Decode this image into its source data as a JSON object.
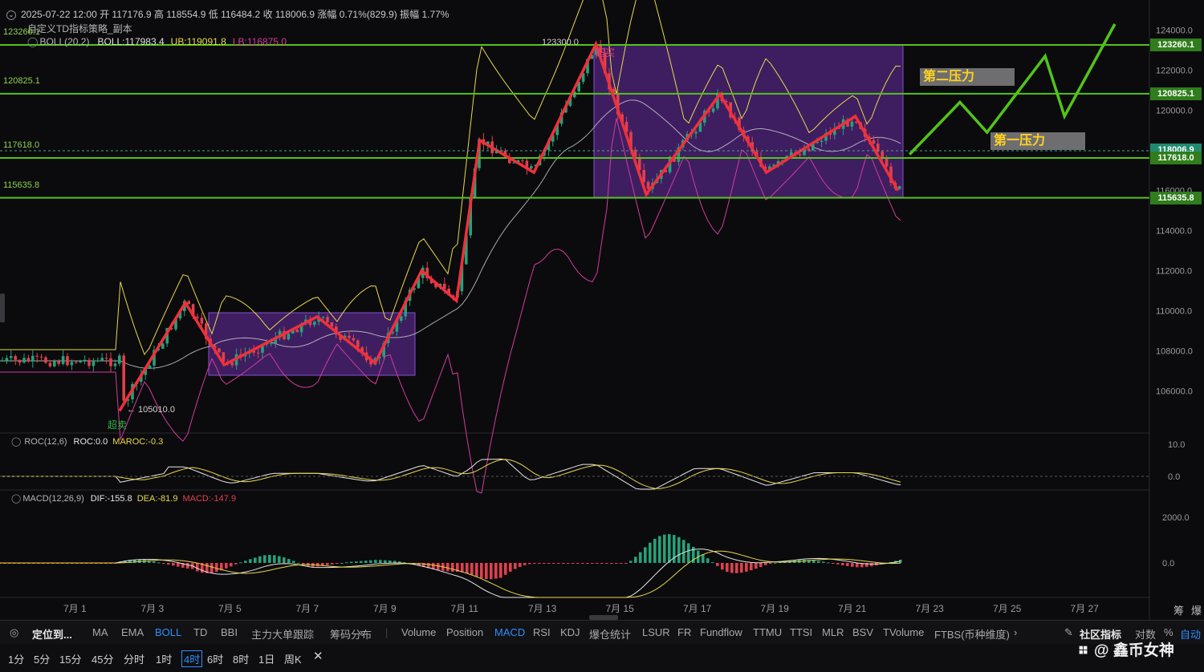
{
  "header": {
    "ohlc": "2025-07-22 12:00  开 117176.9  高 118554.9  低 116484.2  收 118006.9  涨幅 0.71%(829.9)  振幅 1.77%",
    "strategy": "自定义TD指标策略_副本",
    "boll_name": "BOLL(20,2)",
    "boll_mid": "BOLL:117983.4",
    "boll_ub": "UB:119091.8",
    "boll_lb": "LB:116875.0"
  },
  "levels": {
    "l1": "123260.1",
    "l2": "120825.1",
    "l3": "117618.0",
    "l4": "115635.8"
  },
  "annotations": {
    "high_value": "123300.0",
    "overbought": "超买",
    "low_value": "← 105010.0",
    "oversold": "超卖",
    "pressure_2": "第二压力",
    "pressure_1": "第一压力"
  },
  "price_axis": {
    "ticks": [
      "124000.0",
      "122000.0",
      "120000.0",
      "118000.0",
      "116000.0",
      "114000.0",
      "112000.0",
      "110000.0",
      "108000.0",
      "106000.0"
    ],
    "tags": [
      {
        "value": "123260.1",
        "color": "#2f7d1c"
      },
      {
        "value": "120825.1",
        "color": "#2f7d1c"
      },
      {
        "value": "118006.9",
        "color": "#1f8a6e"
      },
      {
        "value": "117618.0",
        "color": "#2f7d1c"
      },
      {
        "value": "115635.8",
        "color": "#2f7d1c"
      }
    ]
  },
  "roc": {
    "name": "ROC(12,6)",
    "value": "ROC:0.0",
    "ma": "MAROC:-0.3",
    "ticks": [
      "10.0",
      "0.0"
    ]
  },
  "macd": {
    "name": "MACD(12,26,9)",
    "dif": "DIF:-155.8",
    "dea": "DEA:-81.9",
    "macd": "MACD:-147.9",
    "ticks": [
      "2000.0",
      "0.0"
    ]
  },
  "dates": [
    "7月 1",
    "7月 3",
    "7月 5",
    "7月 7",
    "7月 9",
    "7月 11",
    "7月 13",
    "7月 15",
    "7月 17",
    "7月 19",
    "7月 21",
    "7月 23",
    "7月 25",
    "7月 27"
  ],
  "corner_icons": [
    "筹",
    "爆"
  ],
  "toolbar_main": {
    "locate": "定位到...",
    "items": [
      "MA",
      "EMA",
      "BOLL",
      "TD",
      "BBI",
      "主力大单跟踪",
      "筹码分布"
    ],
    "active": "BOLL"
  },
  "toolbar_sub": {
    "items": [
      "Volume",
      "Position",
      "MACD",
      "RSI",
      "KDJ",
      "爆仓统计",
      "LSUR",
      "FR",
      "Fundflow",
      "TTMU",
      "TTSI",
      "MLR",
      "BSV",
      "TVolume",
      "FTBS(币种维度)"
    ],
    "active": "MACD"
  },
  "toolbar_right": {
    "community": "社区指标",
    "log": "对数",
    "percent": "%",
    "auto": "自动"
  },
  "timeframes": {
    "items": [
      "1分",
      "5分",
      "15分",
      "45分",
      "分时",
      "1时",
      "4时",
      "6时",
      "8时",
      "1日",
      "周K"
    ],
    "active": "4时"
  },
  "watermark": "@ 鑫币女神",
  "colors": {
    "up": "#26a17b",
    "down": "#e0404d",
    "level": "#52c41a",
    "boll_ub": "#e8d84a",
    "boll_lb": "#d6399c",
    "boll_mid": "#cfcfcf",
    "zigzag": "#f0303a",
    "projection": "#52c41a",
    "box": "#6a2fa8"
  },
  "chart_data": {
    "type": "candlestick",
    "y_range": [
      104000,
      125000
    ],
    "x_dates": [
      "7月 1",
      "7月 3",
      "7月 5",
      "7月 7",
      "7月 9",
      "7月 11",
      "7月 13",
      "7月 15",
      "7月 17",
      "7月 19",
      "7月 21",
      "7月 23",
      "7月 25",
      "7月 27"
    ],
    "horizontal_levels": [
      123260.1,
      120825.1,
      117618.0,
      115635.8
    ],
    "last_close": 118006.9,
    "zigzag": [
      {
        "date": "7月 2.2",
        "price": 105010
      },
      {
        "date": "7月 3.9",
        "price": 110400
      },
      {
        "date": "7月 4.9",
        "price": 107300
      },
      {
        "date": "7月 7.3",
        "price": 109700
      },
      {
        "date": "7月 8.8",
        "price": 107400
      },
      {
        "date": "7月 10.0",
        "price": 112000
      },
      {
        "date": "7月 10.9",
        "price": 110500
      },
      {
        "date": "7月 11.5",
        "price": 118500
      },
      {
        "date": "7月 12.9",
        "price": 116900
      },
      {
        "date": "7月 14.5",
        "price": 123300
      },
      {
        "date": "7月 15.8",
        "price": 115800
      },
      {
        "date": "7月 17.7",
        "price": 120800
      },
      {
        "date": "7月 18.9",
        "price": 116900
      },
      {
        "date": "7月 21.2",
        "price": 119700
      },
      {
        "date": "7月 22.3",
        "price": 116000
      }
    ],
    "projection": [
      {
        "date": "7月 22.6",
        "price": 117800
      },
      {
        "date": "7月 23.9",
        "price": 120400
      },
      {
        "date": "7月 24.6",
        "price": 118900
      },
      {
        "date": "7月 26.1",
        "price": 122700
      },
      {
        "date": "7月 26.6",
        "price": 119700
      },
      {
        "date": "7月 27.9",
        "price": 124300
      }
    ]
  }
}
